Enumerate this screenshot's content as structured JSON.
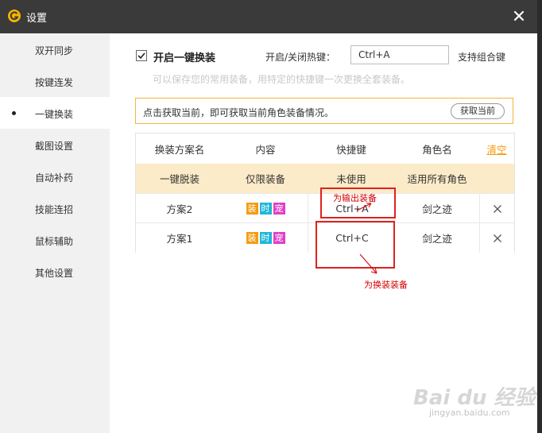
{
  "window": {
    "title": "设置"
  },
  "sidebar": {
    "items": [
      {
        "label": "双开同步"
      },
      {
        "label": "按键连发"
      },
      {
        "label": "一键换装",
        "active": true
      },
      {
        "label": "截图设置"
      },
      {
        "label": "自动补药"
      },
      {
        "label": "技能连招"
      },
      {
        "label": "鼠标辅助"
      },
      {
        "label": "其他设置"
      }
    ]
  },
  "settings": {
    "enable_label": "开启一键换装",
    "enabled": true,
    "hotkey_label": "开启/关闭热键：",
    "hotkey_value": "Ctrl+A",
    "combo_note": "支持组合键",
    "description": "可以保存您的常用装备，用特定的快捷键一次更换全套装备。"
  },
  "notice": {
    "text": "点击获取当前，即可获取当前角色装备情况。",
    "fetch_button": "获取当前"
  },
  "table": {
    "headers": [
      "换装方案名",
      "内容",
      "快捷键",
      "角色名"
    ],
    "clear_label": "清空",
    "rows": [
      {
        "name": "一键脱装",
        "content": "仅限装备",
        "hotkey": "未使用",
        "role": "适用所有角色",
        "highlighted": true
      },
      {
        "name": "方案2",
        "hotkey": "Ctrl+A",
        "role": "剑之迹",
        "tags": [
          "装",
          "时",
          "宠"
        ]
      },
      {
        "name": "方案1",
        "hotkey": "Ctrl+C",
        "role": "剑之迹",
        "tags": [
          "装",
          "时",
          "宠"
        ]
      }
    ],
    "tag_colors": [
      "#f39c12",
      "#1fb7d9",
      "#e040c8"
    ]
  },
  "annotations": {
    "output_label": "为输出装备",
    "change_label": "为换装装备"
  },
  "watermark": {
    "text": "Bai du 经验",
    "sub": "jingyan.baidu.com"
  },
  "colors": {
    "titlebar": "#3a3a3a",
    "accent": "#f39c12",
    "notice_border": "#f3b63c",
    "highlight_row": "#fcebc8",
    "annotation": "#e02020"
  }
}
